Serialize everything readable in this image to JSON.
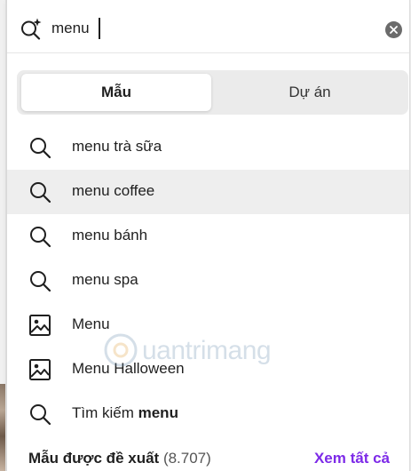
{
  "search": {
    "value": "menu",
    "clear_icon": "close-circle-icon",
    "magic_icon": "magic-search-icon"
  },
  "tabs": [
    {
      "label": "Mẫu",
      "active": true
    },
    {
      "label": "Dự án",
      "active": false
    }
  ],
  "suggestions": [
    {
      "icon": "search-icon",
      "text": "menu trà sữa"
    },
    {
      "icon": "search-icon",
      "text": "menu coffee",
      "highlighted": true
    },
    {
      "icon": "search-icon",
      "text": "menu bánh"
    },
    {
      "icon": "search-icon",
      "text": "menu spa"
    },
    {
      "icon": "image-icon",
      "text": "Menu"
    },
    {
      "icon": "image-icon",
      "text": "Menu Halloween"
    },
    {
      "icon": "search-icon",
      "text_prefix": "Tìm kiếm ",
      "text_bold": "menu"
    }
  ],
  "footer": {
    "title": "Mẫu được đề xuất",
    "count": "(8.707)",
    "link": "Xem tất cả"
  },
  "watermark": {
    "text": "uantrimang"
  },
  "colors": {
    "accent": "#7d2ae8",
    "highlight_row": "#eeeeee",
    "tab_bg": "#ebebeb"
  }
}
